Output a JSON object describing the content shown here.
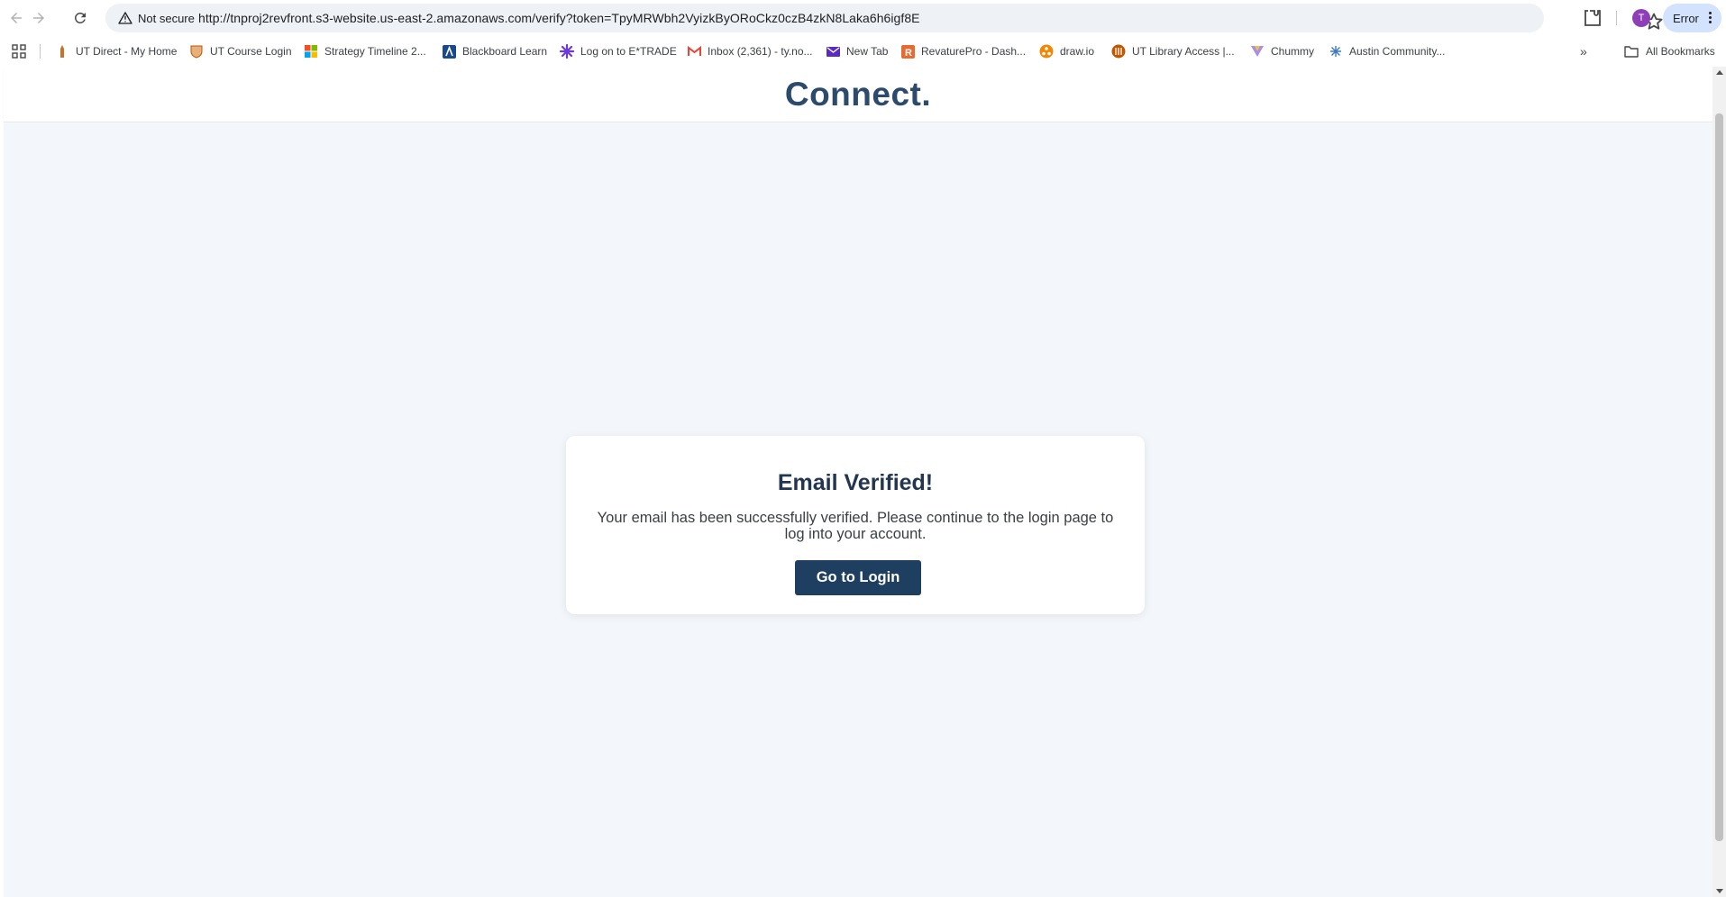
{
  "browser": {
    "security_label": "Not secure",
    "url": "http://tnproj2revfront.s3-website.us-east-2.amazonaws.com/verify?token=TpyMRWbh2VyizkByORoCkz0czB4zkN8Laka6h6igf8E",
    "profile_initial": "T",
    "profile_color": "#8e3fb8",
    "status_chip": "Error",
    "icons": [
      "back-icon",
      "forward-icon",
      "reload-icon",
      "warning-icon",
      "star-icon",
      "extensions-icon",
      "kebab-menu-icon"
    ]
  },
  "bookmarks": {
    "items": [
      {
        "label": "UT Direct - My Home",
        "icon": "ut-tower-icon"
      },
      {
        "label": "UT Course Login",
        "icon": "ut-shield-icon"
      },
      {
        "label": "Strategy Timeline 2...",
        "icon": "microsoft-icon"
      },
      {
        "label": "Blackboard Learn",
        "icon": "blackboard-icon"
      },
      {
        "label": "Log on to E*TRADE",
        "icon": "etrade-icon"
      },
      {
        "label": "Inbox (2,361) - ty.no...",
        "icon": "gmail-icon"
      },
      {
        "label": "New Tab",
        "icon": "mail-envelope-icon"
      },
      {
        "label": "RevaturePro - Dash...",
        "icon": "revature-icon"
      },
      {
        "label": "draw.io",
        "icon": "drawio-icon"
      },
      {
        "label": "UT Library Access |...",
        "icon": "ut-library-icon"
      },
      {
        "label": "Chummy",
        "icon": "chummy-icon"
      },
      {
        "label": "Austin Community...",
        "icon": "acc-icon"
      }
    ],
    "all_bookmarks_label": "All Bookmarks"
  },
  "page": {
    "brand": "Connect.",
    "card": {
      "title": "Email Verified!",
      "message": "Your email has been successfully verified. Please continue to the login page to log into your account.",
      "button_label": "Go to Login"
    }
  },
  "colors": {
    "brand_text": "#2c4a6b",
    "card_title": "#22364f",
    "button_bg": "#1e3f5f",
    "page_bg": "#f3f6fa"
  }
}
